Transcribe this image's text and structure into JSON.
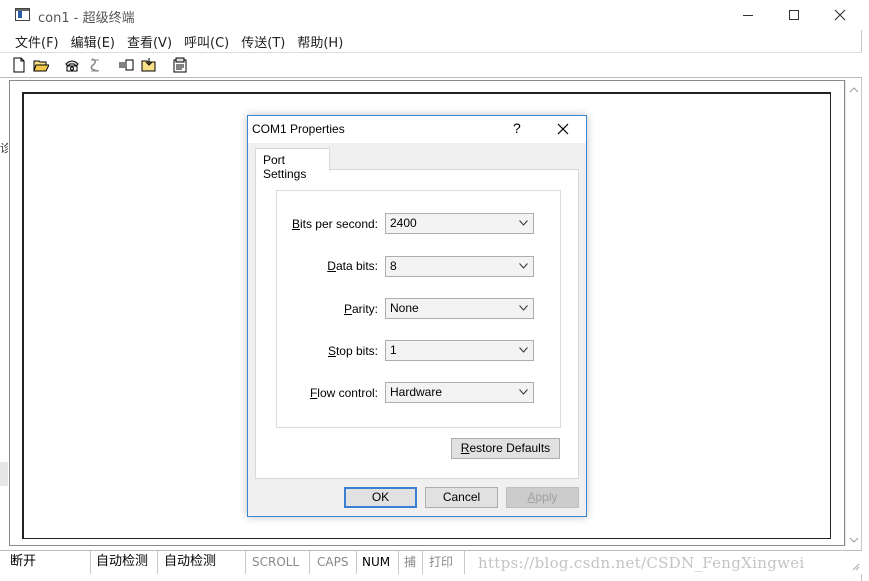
{
  "window": {
    "title": "con1 - 超级终端",
    "menu": [
      "文件(F)",
      "编辑(E)",
      "查看(V)",
      "呼叫(C)",
      "传送(T)",
      "帮助(H)"
    ],
    "left_edge_char": "诊"
  },
  "toolbar": {
    "icons": [
      "new-document-icon",
      "open-folder-icon",
      "call-phone-icon",
      "disconnect-icon",
      "send-file-icon",
      "receive-file-icon",
      "properties-icon"
    ]
  },
  "dialog": {
    "title": "COM1 Properties",
    "help": "?",
    "tab": "Port Settings",
    "fields": [
      {
        "label_pre": "",
        "label_key": "B",
        "label_post": "its per second:",
        "value": "2400"
      },
      {
        "label_pre": "",
        "label_key": "D",
        "label_post": "ata bits:",
        "value": "8"
      },
      {
        "label_pre": "",
        "label_key": "P",
        "label_post": "arity:",
        "value": "None"
      },
      {
        "label_pre": "",
        "label_key": "S",
        "label_post": "top bits:",
        "value": "1"
      },
      {
        "label_pre": "",
        "label_key": "F",
        "label_post": "low control:",
        "value": "Hardware"
      }
    ],
    "restore": {
      "key": "R",
      "rest": "estore Defaults"
    },
    "ok": "OK",
    "cancel": "Cancel",
    "apply": {
      "key": "A",
      "rest": "pply"
    }
  },
  "status": {
    "connection": "断开",
    "detect1": "自动检测",
    "detect2": "自动检测",
    "scroll": "SCROLL",
    "caps": "CAPS",
    "num": "NUM",
    "capture": "捕",
    "print": "打印",
    "watermark": "https://blog.csdn.net/CSDN_FengXingwei"
  }
}
